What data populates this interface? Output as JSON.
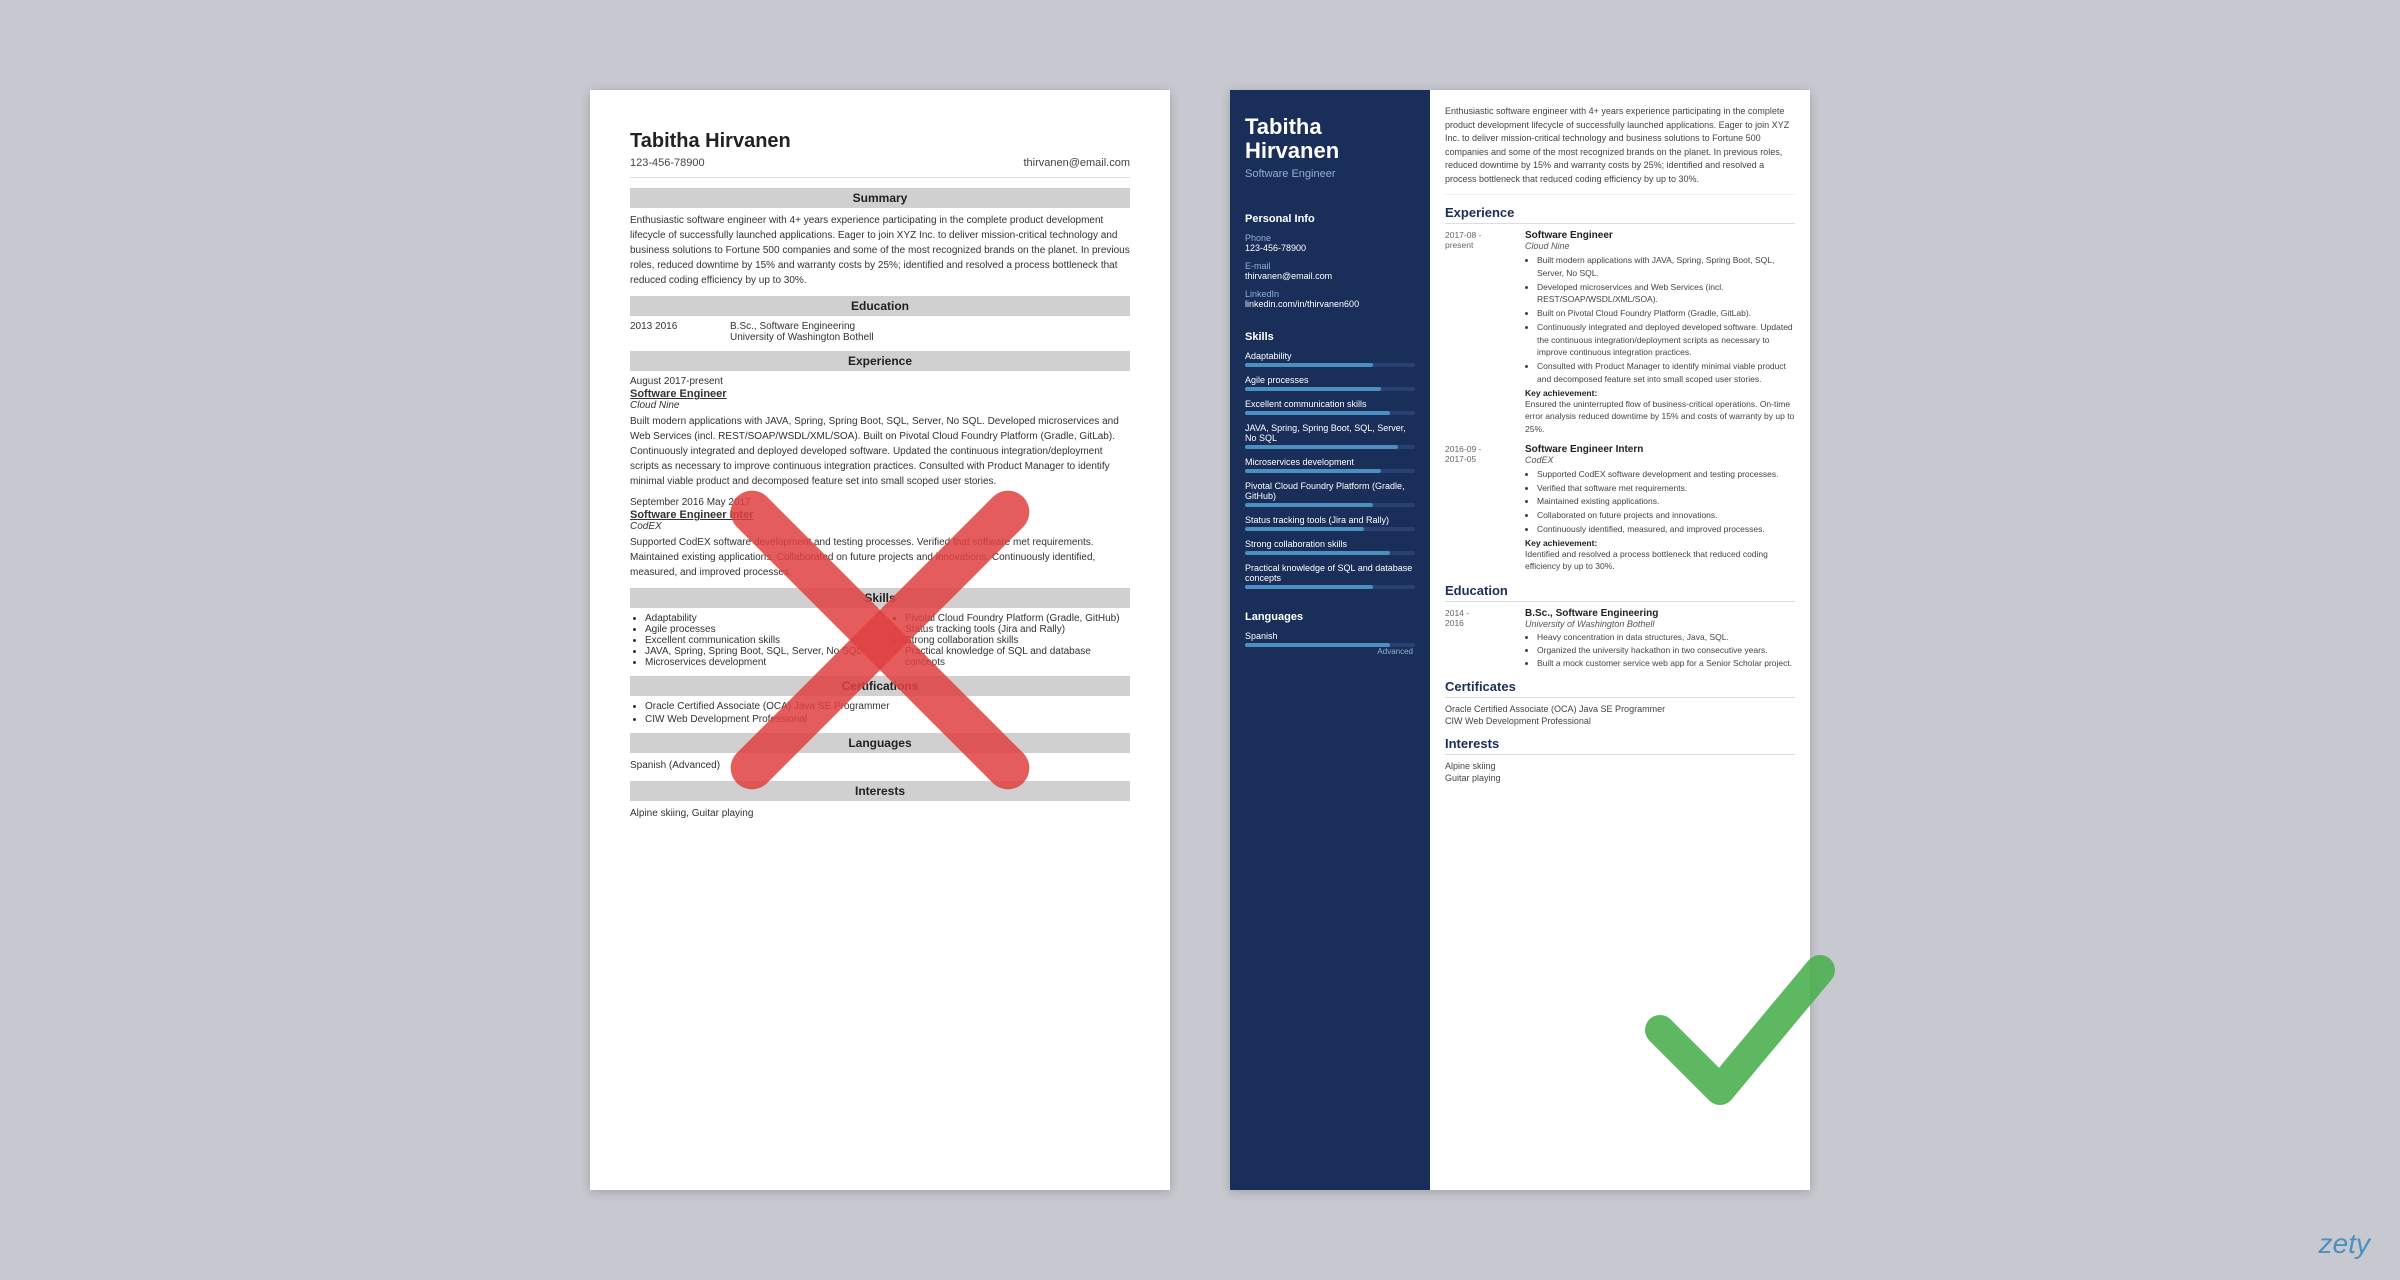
{
  "page": {
    "background_color": "#c8c8d0"
  },
  "plain_resume": {
    "name": "Tabitha Hirvanen",
    "phone": "123-456-78900",
    "email": "thirvanen@email.com",
    "sections": {
      "summary": {
        "title": "Summary",
        "text": "Enthusiastic software engineer with 4+ years experience participating in the complete product development lifecycle of successfully launched applications. Eager to join XYZ Inc. to deliver mission-critical technology and business solutions to Fortune 500 companies and some of the most recognized brands on the planet. In previous roles, reduced downtime by 15% and warranty costs by 25%; identified and resolved a process bottleneck that reduced coding efficiency by up to 30%."
      },
      "education": {
        "title": "Education",
        "items": [
          {
            "dates": "2013  2016",
            "degree": "B.Sc., Software Engineering",
            "school": "University of Washington Bothell"
          }
        ]
      },
      "experience": {
        "title": "Experience",
        "items": [
          {
            "dates": "August 2017-present",
            "title": "Software Engineer",
            "company": "Cloud Nine",
            "description": "Built modern applications with JAVA, Spring, Spring Boot, SQL, Server, No SQL. Developed microservices and Web Services (incl. REST/SOAP/WSDL/XML/SOA). Built on Pivotal Cloud Foundry Platform (Gradle, GitLab). Continuously integrated and deployed developed software. Updated the continuous integration/deployment scripts as necessary to improve continuous integration practices. Consulted with Product Manager to identify minimal viable product and decomposed feature set into small scoped user stories."
          },
          {
            "dates": "September 2016  May 2017",
            "title": "Software Engineer Inter",
            "company": "CodEX",
            "description": "Supported CodEX software development and testing processes. Verified that software met requirements. Maintained existing applications. Collaborated on future projects and innovations. Continuously identified, measured, and improved processes."
          }
        ]
      },
      "skills": {
        "title": "Skills",
        "items_left": [
          "Adaptability",
          "Agile processes",
          "Excellent communication skills",
          "JAVA, Spring, Spring Boot, SQL, Server, No SQL",
          "Microservices development"
        ],
        "items_right": [
          "Pivotal Cloud Foundry Platform (Gradle, GitHub)",
          "Status tracking tools (Jira and Rally)",
          "Strong collaboration skills",
          "Practical knowledge of SQL and database concepts"
        ]
      },
      "certifications": {
        "title": "Certifications",
        "items": [
          "Oracle Certified Associate (OCA) Java SE Programmer",
          "CIW Web Development Professional"
        ]
      },
      "languages": {
        "title": "Languages",
        "text": "Spanish (Advanced)"
      },
      "interests": {
        "title": "Interests",
        "text": "Alpine skiing, Guitar playing"
      }
    }
  },
  "styled_resume": {
    "name_line1": "Tabitha",
    "name_line2": "Hirvanen",
    "title": "Software Engineer",
    "sidebar": {
      "personal_info": {
        "label": "Personal Info",
        "items": [
          {
            "label": "Phone",
            "value": "123-456-78900"
          },
          {
            "label": "E-mail",
            "value": "thirvanen@email.com"
          },
          {
            "label": "LinkedIn",
            "value": "linkedin.com/in/thirvanen600"
          }
        ]
      },
      "skills": {
        "label": "Skills",
        "items": [
          {
            "name": "Adaptability",
            "pct": 75
          },
          {
            "name": "Agile processes",
            "pct": 80
          },
          {
            "name": "Excellent communication skills",
            "pct": 85
          },
          {
            "name": "JAVA, Spring, Spring Boot, SQL, Server, No SQL",
            "pct": 90
          },
          {
            "name": "Microservices development",
            "pct": 80
          },
          {
            "name": "Pivotal Cloud Foundry Platform (Gradle, GitHub)",
            "pct": 75
          },
          {
            "name": "Status tracking tools (Jira and Rally)",
            "pct": 70
          },
          {
            "name": "Strong collaboration skills",
            "pct": 85
          },
          {
            "name": "Practical knowledge of SQL and database concepts",
            "pct": 75
          }
        ]
      },
      "languages": {
        "label": "Languages",
        "items": [
          {
            "name": "Spanish",
            "level": "Advanced",
            "pct": 85
          }
        ]
      }
    },
    "main": {
      "summary": "Enthusiastic software engineer with 4+ years experience participating in the complete product development lifecycle of successfully launched applications. Eager to join XYZ Inc. to deliver mission-critical technology and business solutions to Fortune 500 companies and some of the most recognized brands on the planet. In previous roles, reduced downtime by 15% and warranty costs by 25%; identified and resolved a process bottleneck that reduced coding efficiency by up to 30%.",
      "experience": {
        "title": "Experience",
        "items": [
          {
            "date_start": "2017-08 -",
            "date_end": "present",
            "title": "Software Engineer",
            "company": "Cloud Nine",
            "bullets": [
              "Built modern applications with JAVA, Spring, Spring Boot, SQL, Server, No SQL.",
              "Developed microservices and Web Services (incl. REST/SOAP/WSDL/XML/SOA).",
              "Built on Pivotal Cloud Foundry Platform (Gradle, GitLab).",
              "Continuously integrated and deployed developed software. Updated the continuous integration/deployment scripts as necessary to improve continuous integration practices.",
              "Consulted with Product Manager to identify minimal viable product and decomposed feature set into small scoped user stories."
            ],
            "key_achievement_label": "Key achievement:",
            "key_achievement": "Ensured the uninterrupted flow of business-critical operations. On-time error analysis reduced downtime by 15% and costs of warranty by up to 25%."
          },
          {
            "date_start": "2016-09 -",
            "date_end": "2017-05",
            "title": "Software Engineer Intern",
            "company": "CodEX",
            "bullets": [
              "Supported CodEX software development and testing processes.",
              "Verified that software met requirements.",
              "Maintained existing applications.",
              "Collaborated on future projects and innovations.",
              "Continuously identified, measured, and improved processes."
            ],
            "key_achievement_label": "Key achievement:",
            "key_achievement": "Identified and resolved a process bottleneck that reduced coding efficiency by up to 30%."
          }
        ]
      },
      "education": {
        "title": "Education",
        "items": [
          {
            "date_start": "2014 -",
            "date_end": "2016",
            "degree": "B.Sc., Software Engineering",
            "school": "University of Washington Bothell",
            "bullets": [
              "Heavy concentration in data structures, Java, SQL.",
              "Organized the university hackathon in two consecutive years.",
              "Built a mock customer service web app for a Senior Scholar project."
            ]
          }
        ]
      },
      "certificates": {
        "title": "Certificates",
        "items": [
          "Oracle Certified Associate (OCA) Java SE Programmer",
          "CIW Web Development Professional"
        ]
      },
      "interests": {
        "title": "Interests",
        "items": [
          "Alpine skiing",
          "Guitar playing"
        ]
      }
    }
  },
  "watermark": "zety"
}
